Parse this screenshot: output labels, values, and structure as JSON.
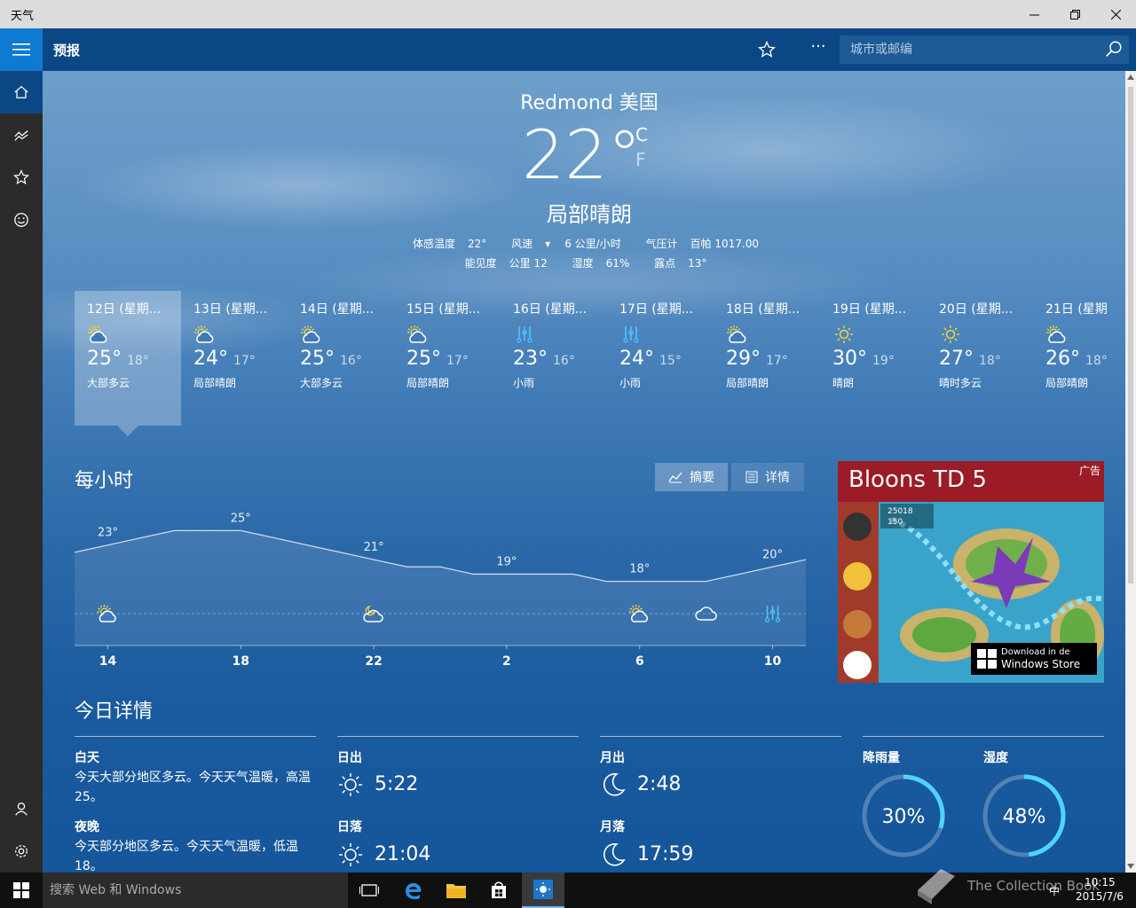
{
  "window": {
    "title": "天气"
  },
  "header": {
    "section_title": "预报",
    "search_placeholder": "城市或邮编"
  },
  "current": {
    "city": "Redmond 美国",
    "temp": "22",
    "unit_c": "C",
    "unit_f": "F",
    "condition": "局部晴朗",
    "feels_label": "体感温度",
    "feels_value": "22°",
    "wind_label": "风速",
    "wind_value": "6 公里/小时",
    "pressure_label": "气压计",
    "pressure_value": "百帕 1017.00",
    "visibility_label": "能见度",
    "visibility_value": "公里 12",
    "humidity_label": "湿度",
    "humidity_value": "61%",
    "dew_label": "露点",
    "dew_value": "13°"
  },
  "daily": [
    {
      "date": "12日 (星期...",
      "high": "25°",
      "low": "18°",
      "desc": "大部多云",
      "icon": "partly-cloudy-icon"
    },
    {
      "date": "13日 (星期...",
      "high": "24°",
      "low": "17°",
      "desc": "局部晴朗",
      "icon": "partly-cloudy-icon"
    },
    {
      "date": "14日 (星期...",
      "high": "25°",
      "low": "16°",
      "desc": "大部多云",
      "icon": "partly-cloudy-icon"
    },
    {
      "date": "15日 (星期...",
      "high": "25°",
      "low": "17°",
      "desc": "局部晴朗",
      "icon": "partly-cloudy-icon"
    },
    {
      "date": "16日 (星期...",
      "high": "23°",
      "low": "16°",
      "desc": "小雨",
      "icon": "rain-icon"
    },
    {
      "date": "17日 (星期...",
      "high": "24°",
      "low": "15°",
      "desc": "小雨",
      "icon": "rain-icon"
    },
    {
      "date": "18日 (星期...",
      "high": "29°",
      "low": "17°",
      "desc": "局部晴朗",
      "icon": "partly-cloudy-icon"
    },
    {
      "date": "19日 (星期...",
      "high": "30°",
      "low": "19°",
      "desc": "晴朗",
      "icon": "sun-icon"
    },
    {
      "date": "20日 (星期...",
      "high": "27°",
      "low": "18°",
      "desc": "晴时多云",
      "icon": "sun-icon"
    },
    {
      "date": "21日 (星期",
      "high": "26°",
      "low": "18°",
      "desc": "局部晴朗",
      "icon": "partly-cloudy-icon"
    }
  ],
  "hourly": {
    "title": "每小时",
    "summary_label": "摘要",
    "details_label": "详情",
    "chart_data": {
      "type": "line",
      "x": [
        13,
        14,
        15,
        16,
        17,
        18,
        19,
        20,
        21,
        22,
        23,
        0,
        1,
        2,
        3,
        4,
        5,
        6,
        7,
        8,
        9,
        10,
        11
      ],
      "values": [
        22,
        23,
        24,
        25,
        25,
        25,
        24,
        23,
        22,
        21,
        20,
        20,
        19,
        19,
        19,
        19,
        18,
        18,
        18,
        18,
        19,
        20,
        21
      ],
      "point_labels": [
        {
          "x": 14,
          "label": "23°"
        },
        {
          "x": 18,
          "label": "25°"
        },
        {
          "x": 22,
          "label": "21°"
        },
        {
          "x": 2,
          "label": "19°"
        },
        {
          "x": 6,
          "label": "18°"
        },
        {
          "x": 10,
          "label": "20°"
        }
      ],
      "tick_labels": [
        "14",
        "18",
        "22",
        "2",
        "6",
        "10"
      ],
      "icons": [
        {
          "x": 14,
          "icon": "partly-cloudy-icon"
        },
        {
          "x": 22,
          "icon": "night-cloudy-icon"
        },
        {
          "x": 6,
          "icon": "partly-cloudy-icon"
        },
        {
          "x": 8,
          "icon": "cloud-icon"
        },
        {
          "x": 10,
          "icon": "rain-icon"
        }
      ],
      "ylim": [
        10,
        30
      ]
    }
  },
  "ad": {
    "title": "Bloons TD 5",
    "badge": "广告",
    "store_line1": "Download in de",
    "store_line2": "Windows Store",
    "score1": "25018",
    "score2": "150"
  },
  "today": {
    "title": "今日详情",
    "day_label": "白天",
    "day_text": "今天大部分地区多云。今天天气温暖，高温 25。",
    "night_label": "夜晚",
    "night_text": "今天部分地区多云。今天天气温暖，低温 18。",
    "sunrise_label": "日出",
    "sunrise_time": "5:22",
    "sunset_label": "日落",
    "sunset_time": "21:04",
    "moonrise_label": "月出",
    "moonrise_time": "2:48",
    "moonset_label": "月落",
    "moonset_time": "17:59",
    "precip_label": "降雨量",
    "precip_value": "30%",
    "precip_fraction": 0.3,
    "humidity_label": "湿度",
    "humidity_value": "48%",
    "humidity_fraction": 0.48
  },
  "taskbar": {
    "search_placeholder": "搜索 Web 和 Windows",
    "time": "10:15",
    "date": "2015/7/6",
    "ime": "中",
    "watermark": "The Collection Book"
  },
  "colors": {
    "accent": "#0f7ad1",
    "header": "#0a4784",
    "nav": "#2b2b2b",
    "gauge": "#4fd3ff",
    "ad_red": "#9b1b26"
  }
}
